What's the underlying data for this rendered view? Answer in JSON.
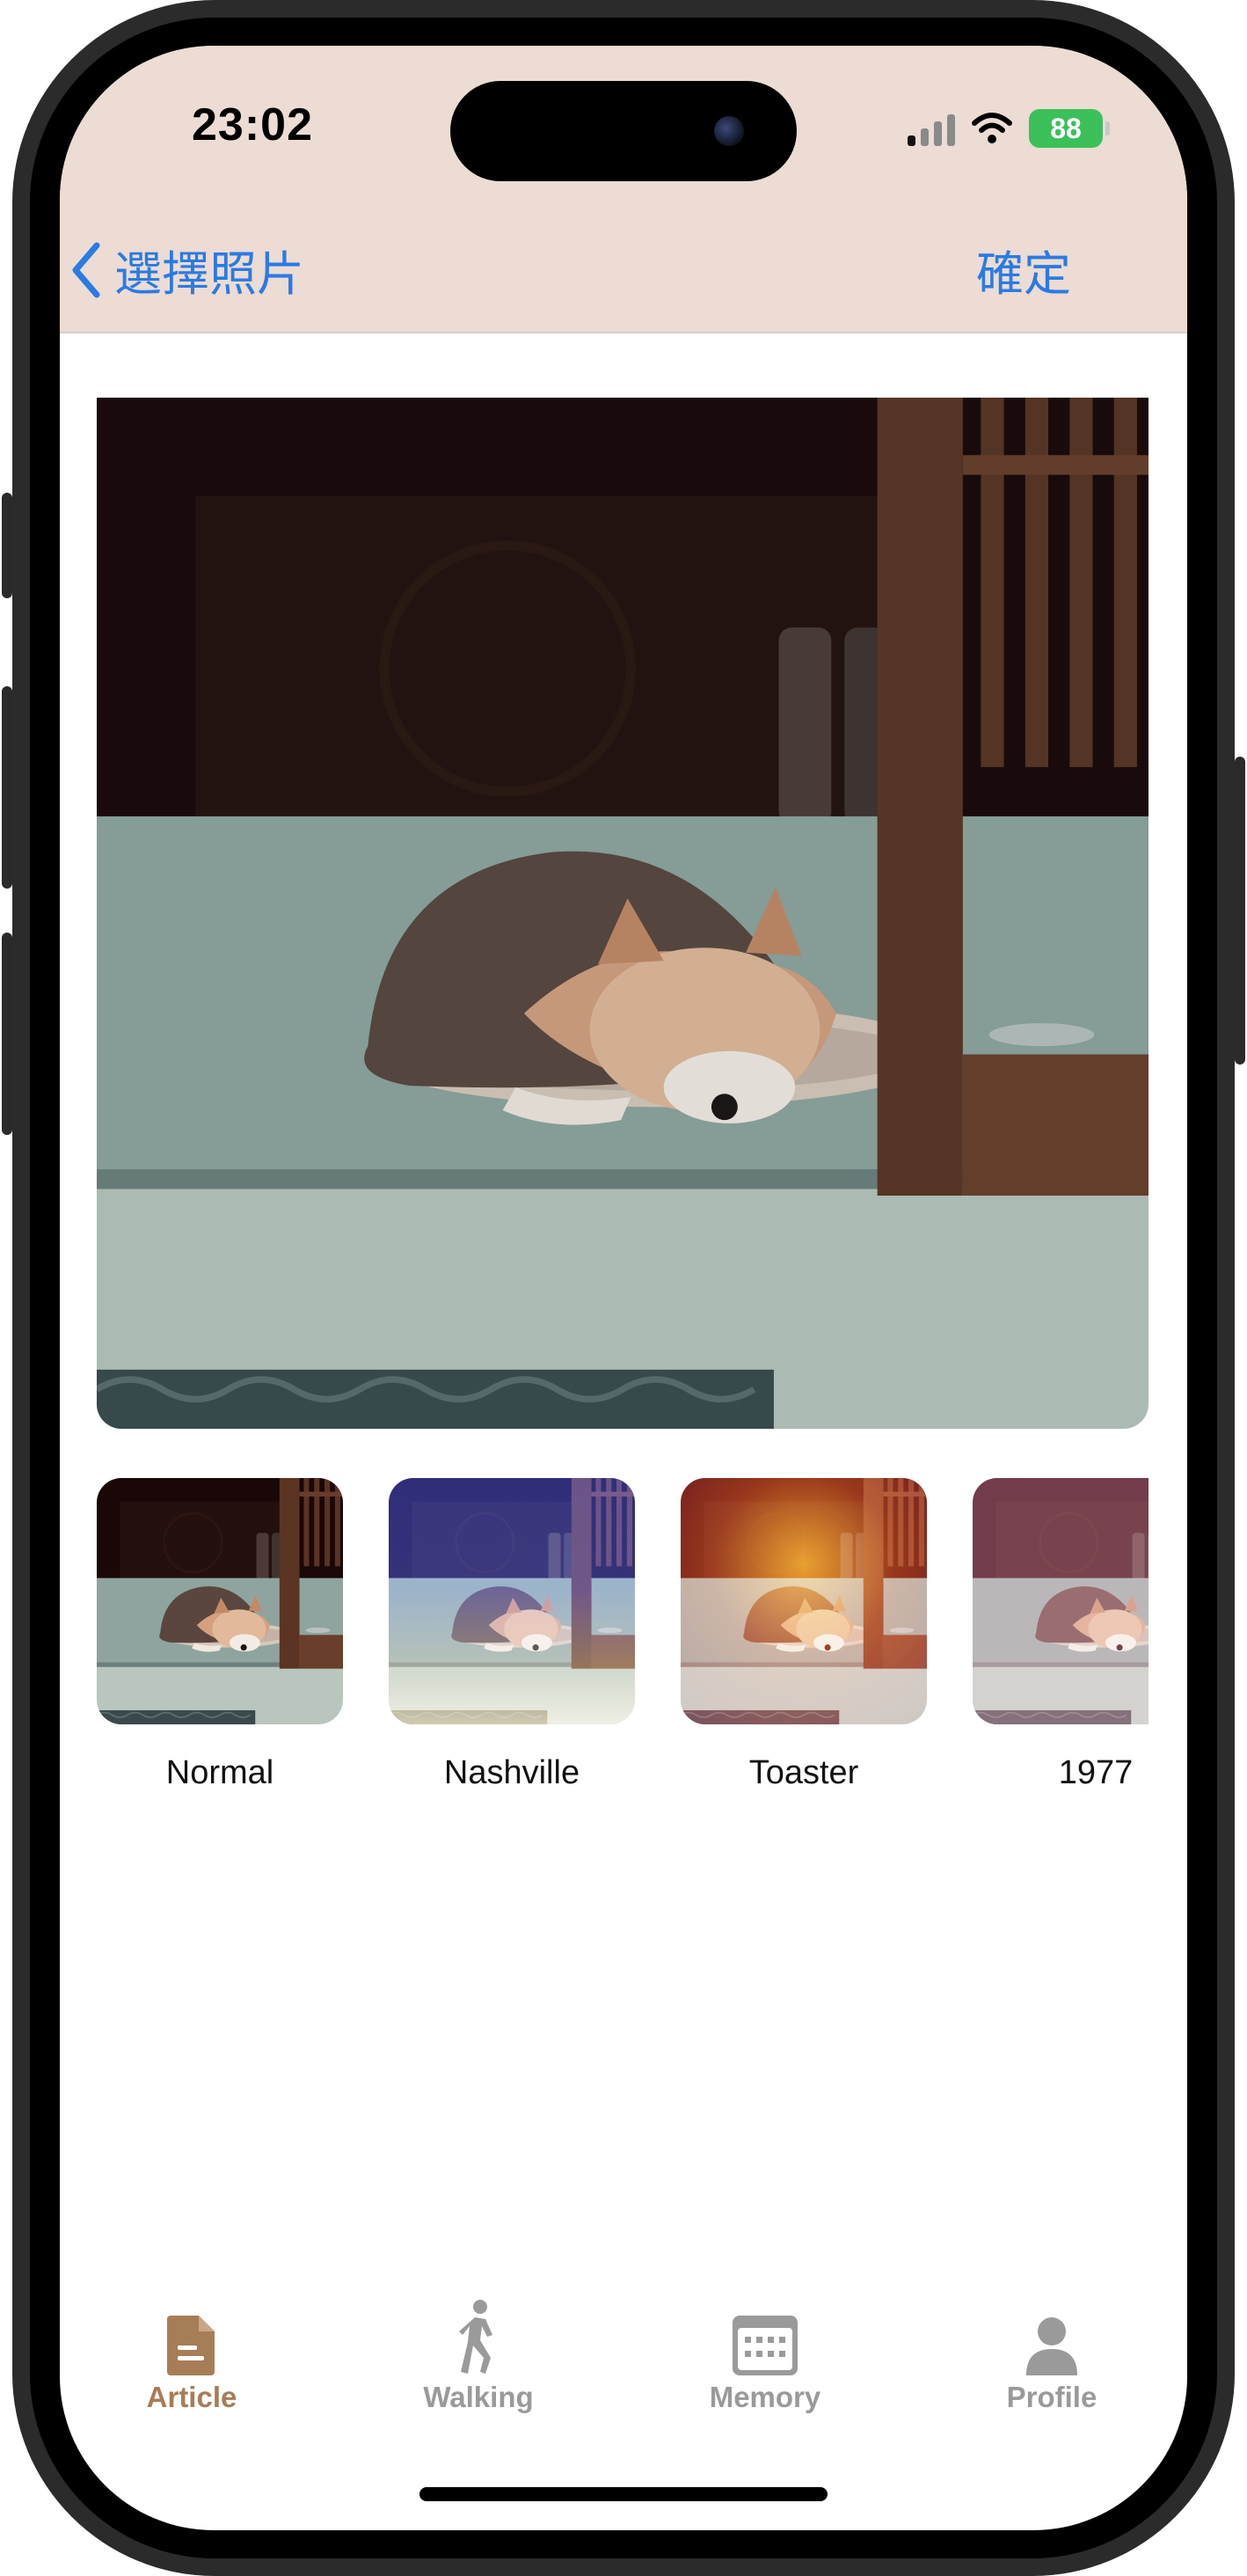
{
  "status_bar": {
    "time": "23:02",
    "battery": "88"
  },
  "nav": {
    "back_label": "選擇照片",
    "confirm_label": "確定"
  },
  "photo_filters": {
    "items": [
      {
        "label": "Normal"
      },
      {
        "label": "Nashville"
      },
      {
        "label": "Toaster"
      },
      {
        "label": "1977"
      }
    ]
  },
  "tabbar": {
    "active": "Article",
    "active_color": "#a77d58",
    "inactive_color": "#9a9a9a",
    "items": [
      {
        "label": "Article",
        "icon": "document-icon"
      },
      {
        "label": "Walking",
        "icon": "walking-person-icon"
      },
      {
        "label": "Memory",
        "icon": "calendar-icon"
      },
      {
        "label": "Profile",
        "icon": "person-icon"
      }
    ]
  }
}
